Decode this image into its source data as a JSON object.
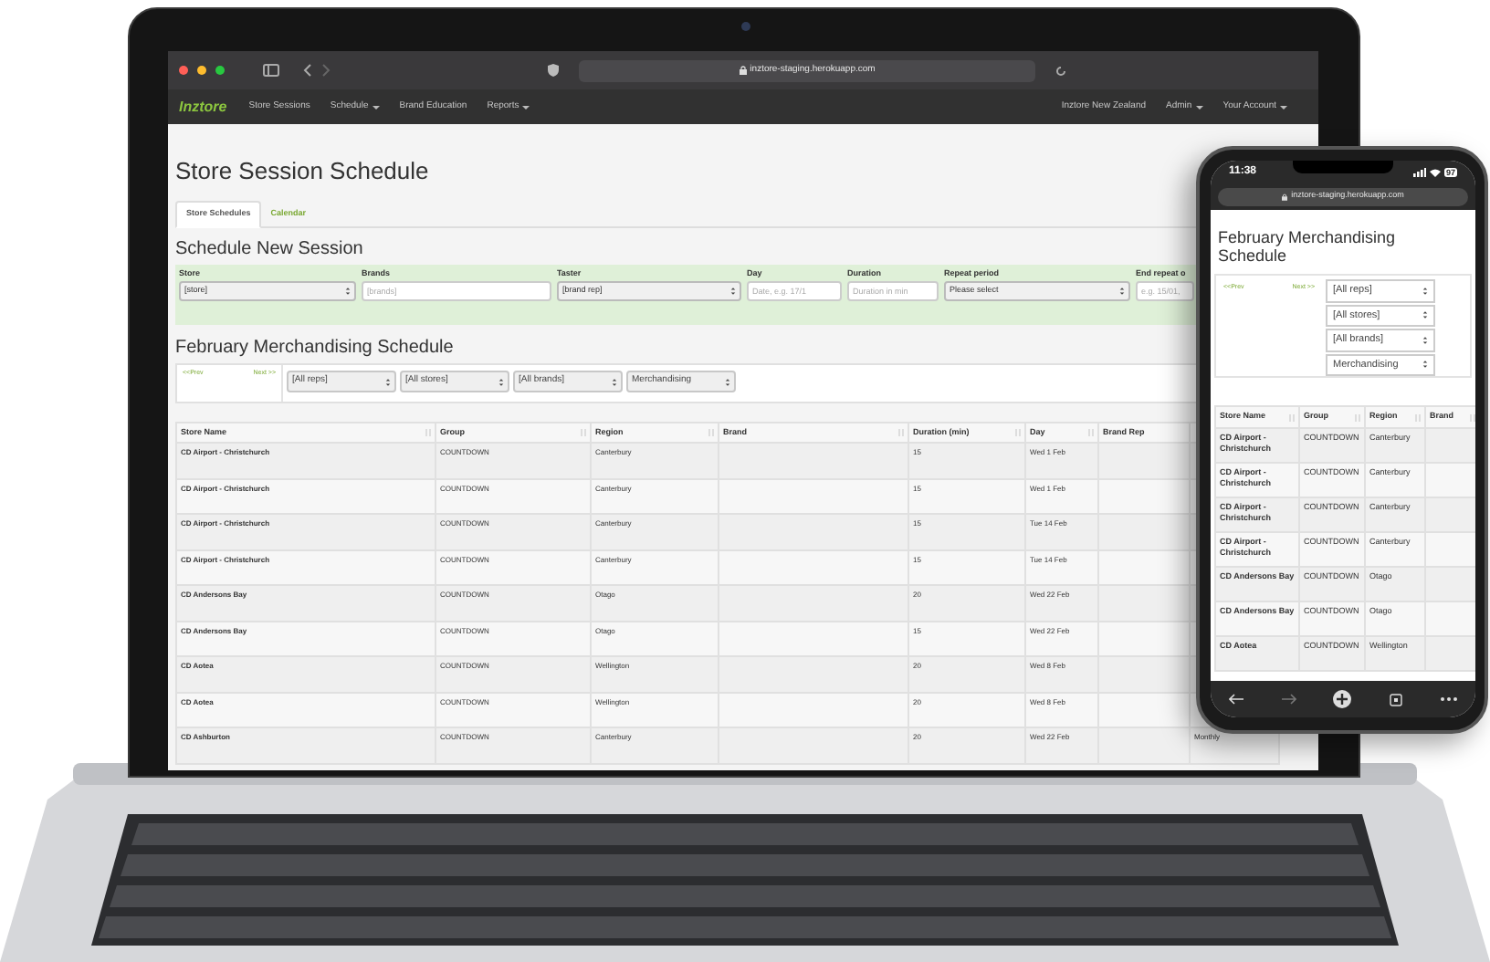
{
  "laptop": {
    "browser": {
      "url": "inztore-staging.herokuapp.com"
    },
    "navbar": {
      "brand": "Inztore",
      "items": [
        {
          "label": "Store Sessions",
          "dropdown": false
        },
        {
          "label": "Schedule",
          "dropdown": true
        },
        {
          "label": "Brand Education",
          "dropdown": false
        },
        {
          "label": "Reports",
          "dropdown": true
        }
      ],
      "right_items": [
        {
          "label": "Inztore New Zealand",
          "dropdown": false
        },
        {
          "label": "Admin",
          "dropdown": true
        },
        {
          "label": "Your Account",
          "dropdown": true
        }
      ]
    },
    "page_title": "Store Session Schedule",
    "tabs": [
      {
        "label": "Store Schedules",
        "selected": true
      },
      {
        "label": "Calendar",
        "selected": false
      }
    ],
    "form": {
      "title": "Schedule New Session",
      "fields": [
        {
          "label": "Store",
          "kind": "select",
          "value": "[store]"
        },
        {
          "label": "Brands",
          "kind": "input",
          "placeholder": "[brands]"
        },
        {
          "label": "Taster",
          "kind": "select",
          "value": "[brand rep]"
        },
        {
          "label": "Day",
          "kind": "input",
          "placeholder": "Date, e.g. 17/1"
        },
        {
          "label": "Duration",
          "kind": "input",
          "placeholder": "Duration in min"
        },
        {
          "label": "Repeat period",
          "kind": "select",
          "value": "Please select"
        },
        {
          "label": "End repeat o",
          "kind": "input",
          "placeholder": "e.g. 15/01,"
        }
      ]
    },
    "schedule": {
      "title": "February Merchandising Schedule",
      "pager": {
        "prev": "<<Prev",
        "next": "Next >>"
      },
      "filters": [
        "[All reps]",
        "[All stores]",
        "[All brands]",
        "Merchandising"
      ],
      "table": {
        "columns": [
          "Store Name",
          "Group",
          "Region",
          "Brand",
          "Duration (min)",
          "Day",
          "Brand Rep"
        ],
        "rows": [
          {
            "store_name": "CD Airport - Christchurch",
            "group": "COUNTDOWN",
            "region": "Canterbury",
            "duration": "15",
            "day": "Wed 1 Feb"
          },
          {
            "store_name": "CD Airport - Christchurch",
            "group": "COUNTDOWN",
            "region": "Canterbury",
            "duration": "15",
            "day": "Wed 1 Feb"
          },
          {
            "store_name": "CD Airport - Christchurch",
            "group": "COUNTDOWN",
            "region": "Canterbury",
            "duration": "15",
            "day": "Tue 14 Feb"
          },
          {
            "store_name": "CD Airport - Christchurch",
            "group": "COUNTDOWN",
            "region": "Canterbury",
            "duration": "15",
            "day": "Tue 14 Feb"
          },
          {
            "store_name": "CD Andersons Bay",
            "group": "COUNTDOWN",
            "region": "Otago",
            "duration": "20",
            "day": "Wed 22 Feb"
          },
          {
            "store_name": "CD Andersons Bay",
            "group": "COUNTDOWN",
            "region": "Otago",
            "duration": "15",
            "day": "Wed 22 Feb"
          },
          {
            "store_name": "CD Aotea",
            "group": "COUNTDOWN",
            "region": "Wellington",
            "duration": "20",
            "day": "Wed 8 Feb"
          },
          {
            "store_name": "CD Aotea",
            "group": "COUNTDOWN",
            "region": "Wellington",
            "duration": "20",
            "day": "Wed 8 Feb"
          },
          {
            "store_name": "CD Ashburton",
            "group": "COUNTDOWN",
            "region": "Canterbury",
            "duration": "20",
            "day": "Wed 22 Feb",
            "column_8": "Monthly"
          }
        ]
      }
    }
  },
  "phone": {
    "time": "11:38",
    "battery": "97",
    "url": "inztore-staging.herokuapp.com",
    "schedule": {
      "title": "February Merchandising Schedule",
      "pager": {
        "prev": "<<Prev",
        "next": "Next >>"
      },
      "filters": [
        "[All reps]",
        "[All stores]",
        "[All brands]",
        "Merchandising"
      ],
      "table": {
        "columns": [
          "Store Name",
          "Group",
          "Region",
          "Brand"
        ],
        "rows": [
          {
            "store_name": "CD Airport - Christchurch",
            "group": "COUNTDOWN",
            "region": "Canterbury"
          },
          {
            "store_name": "CD Airport - Christchurch",
            "group": "COUNTDOWN",
            "region": "Canterbury"
          },
          {
            "store_name": "CD Airport - Christchurch",
            "group": "COUNTDOWN",
            "region": "Canterbury"
          },
          {
            "store_name": "CD Airport - Christchurch",
            "group": "COUNTDOWN",
            "region": "Canterbury"
          },
          {
            "store_name": "CD Andersons Bay",
            "group": "COUNTDOWN",
            "region": "Otago"
          },
          {
            "store_name": "CD Andersons Bay",
            "group": "COUNTDOWN",
            "region": "Otago"
          },
          {
            "store_name": "CD Aotea",
            "group": "COUNTDOWN",
            "region": "Wellington"
          }
        ]
      }
    }
  }
}
